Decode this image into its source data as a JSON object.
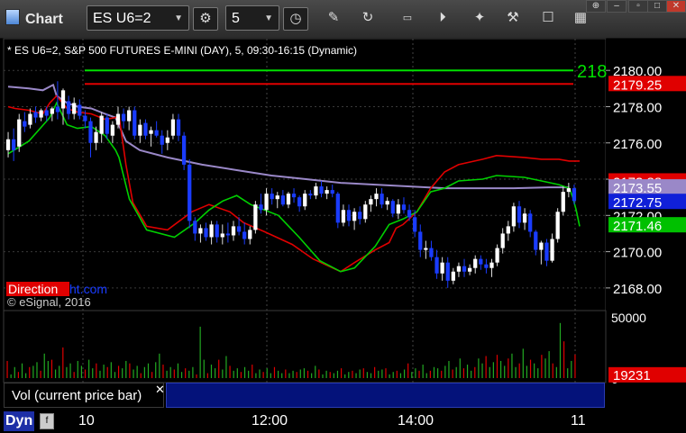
{
  "app": {
    "title": "Chart"
  },
  "toolbar": {
    "symbol": "ES U6=2",
    "interval": "5",
    "buttons": [
      "settings-icon",
      "clock-icon",
      "pencil-icon",
      "refresh-icon",
      "get-icon",
      "play-icon",
      "tools-icon",
      "chat-icon",
      "layout-icon"
    ]
  },
  "chart_data": {
    "type": "candlestick",
    "title": "* ES U6=2, S&P 500 FUTURES E-MINI (DAY), 5, 09:30-16:15 (Dynamic)",
    "copyright": "© eSignal, 2016",
    "watermark_red": "Direction",
    "watermark_blue": "ht.com",
    "ylim": [
      2167.0,
      2181.4
    ],
    "y_ticks": [
      "2180.00",
      "2178.00",
      "2176.00",
      "2174.00",
      "2172.00",
      "2170.00",
      "2168.00"
    ],
    "x_ticks": [
      "10",
      "12:00",
      "14:00",
      "11"
    ],
    "right_labels": [
      {
        "text": "2179.25",
        "value": 2179.25,
        "color": "#e00000"
      },
      {
        "text": "2173.88",
        "value": 2173.88,
        "color": "#e00000"
      },
      {
        "text": "2173.55",
        "value": 2173.55,
        "color": "#9a88c8"
      },
      {
        "text": "2172.75",
        "value": 2172.75,
        "color": "#1020d8"
      },
      {
        "text": "2171.46",
        "value": 2171.46,
        "color": "#00c000"
      }
    ],
    "green_level": {
      "value": 2180.0,
      "label": "218"
    },
    "red_level": {
      "value": 2179.25
    },
    "candles_ohlc": [
      [
        2175.6,
        2176.6,
        2175.2,
        2176.2
      ],
      [
        2176.2,
        2176.8,
        2175.0,
        2175.6
      ],
      [
        2175.8,
        2177.6,
        2175.5,
        2177.3
      ],
      [
        2177.2,
        2177.7,
        2176.6,
        2176.9
      ],
      [
        2177.0,
        2177.9,
        2176.8,
        2177.6
      ],
      [
        2177.7,
        2178.0,
        2177.1,
        2177.4
      ],
      [
        2177.4,
        2177.9,
        2177.2,
        2177.8
      ],
      [
        2177.8,
        2178.0,
        2177.2,
        2177.5
      ],
      [
        2177.6,
        2178.0,
        2177.2,
        2177.9
      ],
      [
        2178.0,
        2179.4,
        2177.3,
        2177.7
      ],
      [
        2177.9,
        2179.0,
        2177.0,
        2178.9
      ],
      [
        2178.3,
        2178.6,
        2177.3,
        2177.6
      ],
      [
        2177.6,
        2178.5,
        2177.3,
        2178.2
      ],
      [
        2178.1,
        2178.4,
        2177.3,
        2177.5
      ],
      [
        2177.5,
        2177.8,
        2176.8,
        2177.2
      ],
      [
        2177.2,
        2177.4,
        2175.2,
        2176.0
      ],
      [
        2176.0,
        2176.9,
        2175.6,
        2176.6
      ],
      [
        2176.5,
        2177.7,
        2176.0,
        2177.5
      ],
      [
        2177.4,
        2177.6,
        2176.2,
        2176.5
      ],
      [
        2176.4,
        2177.2,
        2176.0,
        2177.0
      ],
      [
        2177.0,
        2178.0,
        2176.8,
        2177.6
      ],
      [
        2177.6,
        2177.9,
        2176.8,
        2177.2
      ],
      [
        2177.2,
        2178.0,
        2176.7,
        2177.8
      ],
      [
        2177.8,
        2178.0,
        2176.2,
        2176.4
      ],
      [
        2176.4,
        2177.3,
        2176.0,
        2177.0
      ],
      [
        2177.1,
        2177.3,
        2176.2,
        2176.4
      ],
      [
        2176.5,
        2176.9,
        2175.8,
        2176.7
      ],
      [
        2176.7,
        2177.2,
        2176.3,
        2176.4
      ],
      [
        2176.4,
        2176.7,
        2175.4,
        2175.9
      ],
      [
        2176.0,
        2176.7,
        2175.6,
        2176.3
      ],
      [
        2176.4,
        2177.6,
        2176.2,
        2177.3
      ],
      [
        2177.3,
        2177.6,
        2176.1,
        2176.4
      ],
      [
        2176.4,
        2176.6,
        2174.5,
        2174.8
      ],
      [
        2174.8,
        2175.1,
        2171.3,
        2171.7
      ],
      [
        2171.7,
        2171.9,
        2170.6,
        2171.0
      ],
      [
        2171.0,
        2171.5,
        2170.5,
        2171.3
      ],
      [
        2171.3,
        2171.6,
        2170.6,
        2170.8
      ],
      [
        2170.8,
        2171.7,
        2170.4,
        2171.5
      ],
      [
        2171.5,
        2171.7,
        2170.5,
        2170.8
      ],
      [
        2170.8,
        2171.5,
        2170.4,
        2171.0
      ],
      [
        2171.0,
        2171.6,
        2170.5,
        2170.9
      ],
      [
        2170.9,
        2171.7,
        2170.6,
        2171.4
      ],
      [
        2171.4,
        2171.9,
        2170.9,
        2171.1
      ],
      [
        2171.1,
        2171.6,
        2170.4,
        2170.7
      ],
      [
        2170.7,
        2171.4,
        2170.4,
        2171.2
      ],
      [
        2171.2,
        2172.8,
        2171.0,
        2172.6
      ],
      [
        2172.6,
        2173.2,
        2172.1,
        2172.3
      ],
      [
        2172.3,
        2173.5,
        2172.0,
        2173.2
      ],
      [
        2173.2,
        2173.5,
        2172.6,
        2172.9
      ],
      [
        2172.9,
        2173.3,
        2172.4,
        2173.1
      ],
      [
        2173.1,
        2173.4,
        2172.5,
        2172.6
      ],
      [
        2172.6,
        2173.3,
        2172.4,
        2173.2
      ],
      [
        2173.2,
        2173.5,
        2172.7,
        2173.0
      ],
      [
        2173.0,
        2173.1,
        2172.2,
        2172.5
      ],
      [
        2172.5,
        2173.4,
        2172.3,
        2173.2
      ],
      [
        2173.2,
        2173.4,
        2172.9,
        2173.1
      ],
      [
        2173.1,
        2173.8,
        2172.9,
        2173.6
      ],
      [
        2173.6,
        2173.9,
        2173.0,
        2173.2
      ],
      [
        2173.2,
        2173.6,
        2172.9,
        2173.4
      ],
      [
        2173.4,
        2173.7,
        2173.0,
        2173.2
      ],
      [
        2173.2,
        2173.3,
        2171.3,
        2171.6
      ],
      [
        2171.6,
        2172.6,
        2171.4,
        2172.3
      ],
      [
        2172.3,
        2172.6,
        2171.4,
        2171.7
      ],
      [
        2171.7,
        2172.4,
        2171.2,
        2172.2
      ],
      [
        2172.2,
        2172.5,
        2171.5,
        2171.8
      ],
      [
        2171.8,
        2172.8,
        2171.6,
        2172.6
      ],
      [
        2172.6,
        2173.1,
        2172.2,
        2172.9
      ],
      [
        2172.9,
        2173.5,
        2172.5,
        2173.2
      ],
      [
        2173.2,
        2173.5,
        2172.4,
        2172.6
      ],
      [
        2172.6,
        2173.0,
        2172.3,
        2172.8
      ],
      [
        2172.8,
        2172.9,
        2171.9,
        2172.1
      ],
      [
        2172.1,
        2172.9,
        2171.8,
        2172.6
      ],
      [
        2172.6,
        2173.0,
        2172.1,
        2172.3
      ],
      [
        2172.3,
        2172.6,
        2171.7,
        2171.9
      ],
      [
        2171.9,
        2172.3,
        2170.8,
        2171.1
      ],
      [
        2171.1,
        2171.5,
        2169.7,
        2170.1
      ],
      [
        2170.1,
        2170.6,
        2169.6,
        2170.2
      ],
      [
        2170.2,
        2170.6,
        2169.5,
        2169.7
      ],
      [
        2169.7,
        2170.1,
        2168.5,
        2168.8
      ],
      [
        2168.8,
        2169.7,
        2168.4,
        2169.4
      ],
      [
        2169.4,
        2169.7,
        2168.0,
        2168.4
      ],
      [
        2168.4,
        2169.1,
        2168.2,
        2168.9
      ],
      [
        2168.9,
        2169.4,
        2168.6,
        2169.2
      ],
      [
        2169.2,
        2169.6,
        2168.6,
        2168.9
      ],
      [
        2168.9,
        2169.3,
        2168.7,
        2169.1
      ],
      [
        2169.1,
        2169.8,
        2168.8,
        2169.6
      ],
      [
        2169.6,
        2169.8,
        2169.0,
        2169.3
      ],
      [
        2169.3,
        2169.6,
        2168.8,
        2169.1
      ],
      [
        2169.1,
        2169.6,
        2168.6,
        2169.4
      ],
      [
        2169.4,
        2170.4,
        2169.2,
        2170.2
      ],
      [
        2170.2,
        2171.3,
        2169.9,
        2171.0
      ],
      [
        2171.0,
        2171.7,
        2170.6,
        2171.4
      ],
      [
        2171.4,
        2172.7,
        2171.1,
        2172.5
      ],
      [
        2172.5,
        2172.8,
        2171.3,
        2171.6
      ],
      [
        2171.6,
        2172.4,
        2171.2,
        2172.1
      ],
      [
        2172.1,
        2172.3,
        2170.8,
        2171.1
      ],
      [
        2171.1,
        2171.2,
        2169.8,
        2170.1
      ],
      [
        2170.1,
        2170.6,
        2169.3,
        2170.5
      ],
      [
        2170.5,
        2170.7,
        2169.2,
        2169.5
      ],
      [
        2169.5,
        2171.0,
        2169.4,
        2170.7
      ],
      [
        2170.7,
        2172.4,
        2170.5,
        2172.2
      ],
      [
        2172.2,
        2173.6,
        2172.0,
        2173.3
      ],
      [
        2173.3,
        2173.8,
        2173.0,
        2173.5
      ],
      [
        2173.5,
        2173.7,
        2172.6,
        2172.8
      ]
    ],
    "indicators": {
      "green_avg": [
        [
          0,
          2175.4
        ],
        [
          6,
          2176.1
        ],
        [
          12,
          2177.4
        ],
        [
          14,
          2178.2
        ],
        [
          17,
          2177.0
        ],
        [
          20,
          2176.8
        ],
        [
          24,
          2176.9
        ],
        [
          28,
          2176.4
        ],
        [
          31,
          2175.6
        ],
        [
          32,
          2175.2
        ],
        [
          35,
          2172.9
        ],
        [
          40,
          2171.2
        ],
        [
          48,
          2170.8
        ],
        [
          54,
          2171.6
        ],
        [
          58,
          2172.3
        ],
        [
          62,
          2172.8
        ],
        [
          66,
          2173.1
        ],
        [
          70,
          2172.6
        ],
        [
          78,
          2172.0
        ],
        [
          84,
          2170.8
        ],
        [
          90,
          2169.5
        ],
        [
          96,
          2168.9
        ],
        [
          100,
          2169.1
        ],
        [
          106,
          2170.3
        ],
        [
          110,
          2171.5
        ],
        [
          114,
          2171.8
        ],
        [
          118,
          2172.2
        ],
        [
          122,
          2173.3
        ],
        [
          126,
          2173.5
        ],
        [
          130,
          2173.9
        ],
        [
          137,
          2174.0
        ],
        [
          141,
          2174.2
        ],
        [
          149,
          2174.1
        ],
        [
          154,
          2173.9
        ],
        [
          159,
          2173.7
        ],
        [
          162,
          2173.5
        ],
        [
          163,
          2173.0
        ],
        [
          164,
          2172.3
        ],
        [
          165,
          2171.4
        ]
      ],
      "red_avg": [
        [
          0,
          2178.0
        ],
        [
          2,
          2177.9
        ],
        [
          6,
          2177.8
        ],
        [
          10,
          2177.6
        ],
        [
          12,
          2178.2
        ],
        [
          14,
          2178.6
        ],
        [
          17,
          2177.9
        ],
        [
          20,
          2177.7
        ],
        [
          24,
          2177.6
        ],
        [
          28,
          2177.3
        ],
        [
          31,
          2177.4
        ],
        [
          32,
          2177.5
        ],
        [
          34,
          2174.8
        ],
        [
          36,
          2172.7
        ],
        [
          40,
          2171.4
        ],
        [
          46,
          2171.2
        ],
        [
          53,
          2172.2
        ],
        [
          58,
          2172.6
        ],
        [
          64,
          2172.2
        ],
        [
          68,
          2171.6
        ],
        [
          74,
          2171.1
        ],
        [
          82,
          2170.4
        ],
        [
          88,
          2169.6
        ],
        [
          96,
          2168.9
        ],
        [
          100,
          2169.4
        ],
        [
          106,
          2170.1
        ],
        [
          110,
          2170.5
        ],
        [
          112,
          2171.3
        ],
        [
          114,
          2171.5
        ],
        [
          118,
          2172.2
        ],
        [
          122,
          2173.5
        ],
        [
          126,
          2174.4
        ],
        [
          130,
          2174.8
        ],
        [
          137,
          2175.1
        ],
        [
          141,
          2175.3
        ],
        [
          149,
          2175.2
        ],
        [
          154,
          2175.1
        ],
        [
          159,
          2175.1
        ],
        [
          162,
          2175.0
        ],
        [
          165,
          2175.0
        ]
      ],
      "purple_avg": [
        [
          0,
          2179.1
        ],
        [
          6,
          2179.0
        ],
        [
          10,
          2178.9
        ],
        [
          13,
          2179.2
        ],
        [
          14,
          2178.6
        ],
        [
          17,
          2178.2
        ],
        [
          20,
          2178.0
        ],
        [
          24,
          2177.9
        ],
        [
          28,
          2177.6
        ],
        [
          31,
          2177.4
        ],
        [
          34,
          2176.1
        ],
        [
          38,
          2175.6
        ],
        [
          46,
          2175.2
        ],
        [
          56,
          2174.8
        ],
        [
          66,
          2174.5
        ],
        [
          76,
          2174.2
        ],
        [
          86,
          2174.0
        ],
        [
          96,
          2173.8
        ],
        [
          106,
          2173.7
        ],
        [
          116,
          2173.6
        ],
        [
          126,
          2173.5
        ],
        [
          136,
          2173.5
        ],
        [
          146,
          2173.5
        ],
        [
          156,
          2173.55
        ],
        [
          162,
          2173.55
        ]
      ]
    },
    "volume": {
      "ylim": [
        0,
        50000
      ],
      "y_ticks": [
        "50000",
        "0"
      ],
      "last_label": "19231",
      "bars": [
        14000,
        3000,
        9000,
        5000,
        12000,
        4000,
        9000,
        10000,
        13000,
        6000,
        20000,
        14000,
        15000,
        7000,
        10000,
        25000,
        9000,
        12000,
        5000,
        14000,
        10000,
        7000,
        15000,
        8000,
        12000,
        6000,
        11000,
        9000,
        13000,
        5000,
        10000,
        8000,
        14000,
        12000,
        7000,
        10000,
        4000,
        9000,
        12000,
        5000,
        13000,
        20000,
        11000,
        6000,
        9000,
        7000,
        12000,
        5000,
        8000,
        6000,
        9000,
        3000,
        42000,
        15000,
        4000,
        11000,
        8000,
        15000,
        7000,
        18000,
        10000,
        6000,
        8000,
        5000,
        9000,
        6000,
        11000,
        4000,
        7000,
        5000,
        8000,
        4000,
        9000,
        6000,
        4000,
        7000,
        4000,
        6000,
        5000,
        7000,
        8000,
        6000,
        4000,
        10000,
        7000,
        3000,
        6000,
        5000,
        4000,
        6000,
        8000,
        3000,
        5000,
        6000,
        4000,
        7000,
        8000,
        5000,
        4000,
        9000,
        6000,
        7000,
        8000,
        3000,
        5000,
        6000,
        4000,
        7000,
        12000,
        5000,
        8000,
        6000,
        11000,
        4000,
        6000,
        9000,
        8000,
        6000,
        10000,
        14000,
        7000,
        9000,
        16000,
        8000,
        11000,
        6000,
        9000,
        16000,
        12000,
        18000,
        9000,
        13000,
        19000,
        14000,
        10000,
        16000,
        20000,
        9000,
        12000,
        24000,
        10000,
        15000,
        12000,
        8000,
        19000,
        16000,
        22000,
        12000,
        9000,
        45000,
        30000,
        8000,
        14000,
        19231
      ]
    },
    "volume_indicator": "Vol (current price bar)"
  },
  "bottom": {
    "dyn_label": "Dyn",
    "fib_label": "fib"
  }
}
